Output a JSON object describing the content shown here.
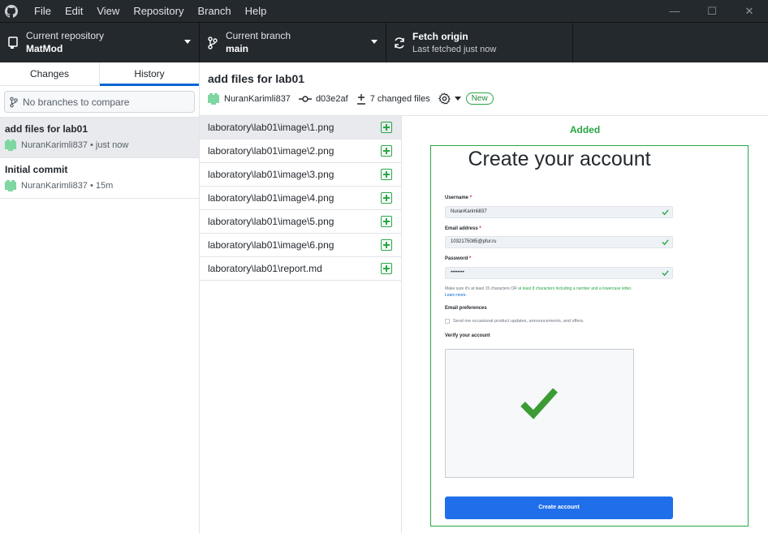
{
  "menu": {
    "items": [
      "File",
      "Edit",
      "View",
      "Repository",
      "Branch",
      "Help"
    ]
  },
  "window_controls": {
    "minimize": "—",
    "maximize": "☐",
    "close": "✕"
  },
  "toolbar": {
    "repo_label": "Current repository",
    "repo_value": "MatMod",
    "branch_label": "Current branch",
    "branch_value": "main",
    "fetch_label": "Fetch origin",
    "fetch_sub": "Last fetched just now"
  },
  "sidebar": {
    "tabs": [
      "Changes",
      "History"
    ],
    "active_tab": "History",
    "compare_placeholder": "No branches to compare",
    "commits": [
      {
        "title": "add files for lab01",
        "author": "NuranKarimli837",
        "time": "just now"
      },
      {
        "title": "Initial commit",
        "author": "NuranKarimli837",
        "time": "15m"
      }
    ]
  },
  "commit": {
    "title": "add files for lab01",
    "author": "NuranKarimli837",
    "sha": "d03e2af",
    "changed_files": "7 changed files",
    "badge": "New"
  },
  "files": [
    "laboratory\\lab01\\image\\1.png",
    "laboratory\\lab01\\image\\2.png",
    "laboratory\\lab01\\image\\3.png",
    "laboratory\\lab01\\image\\4.png",
    "laboratory\\lab01\\image\\5.png",
    "laboratory\\lab01\\image\\6.png",
    "laboratory\\lab01\\report.md"
  ],
  "diff": {
    "status": "Added",
    "preview": {
      "title": "Create your account",
      "username_label": "Username",
      "username_value": "NuranKarimli837",
      "email_label": "Email address",
      "email_value": "1032175085@pfur.ru",
      "password_label": "Password",
      "password_value": "••••••••",
      "required_mark": "*",
      "note_prefix": "Make sure it's at least 15 characters OR ",
      "note_green": "at least 8 characters including a number and a lowercase letter.",
      "note_link": "Learn more.",
      "email_pref_title": "Email preferences",
      "email_pref_option": "Send me occasional product updates, announcements, and offers.",
      "verify_title": "Verify your account",
      "button_label": "Create account"
    }
  },
  "colors": {
    "chrome": "#24292e",
    "accent": "#0366d6",
    "added": "#28a745",
    "avatar": "#7ed6a0"
  }
}
